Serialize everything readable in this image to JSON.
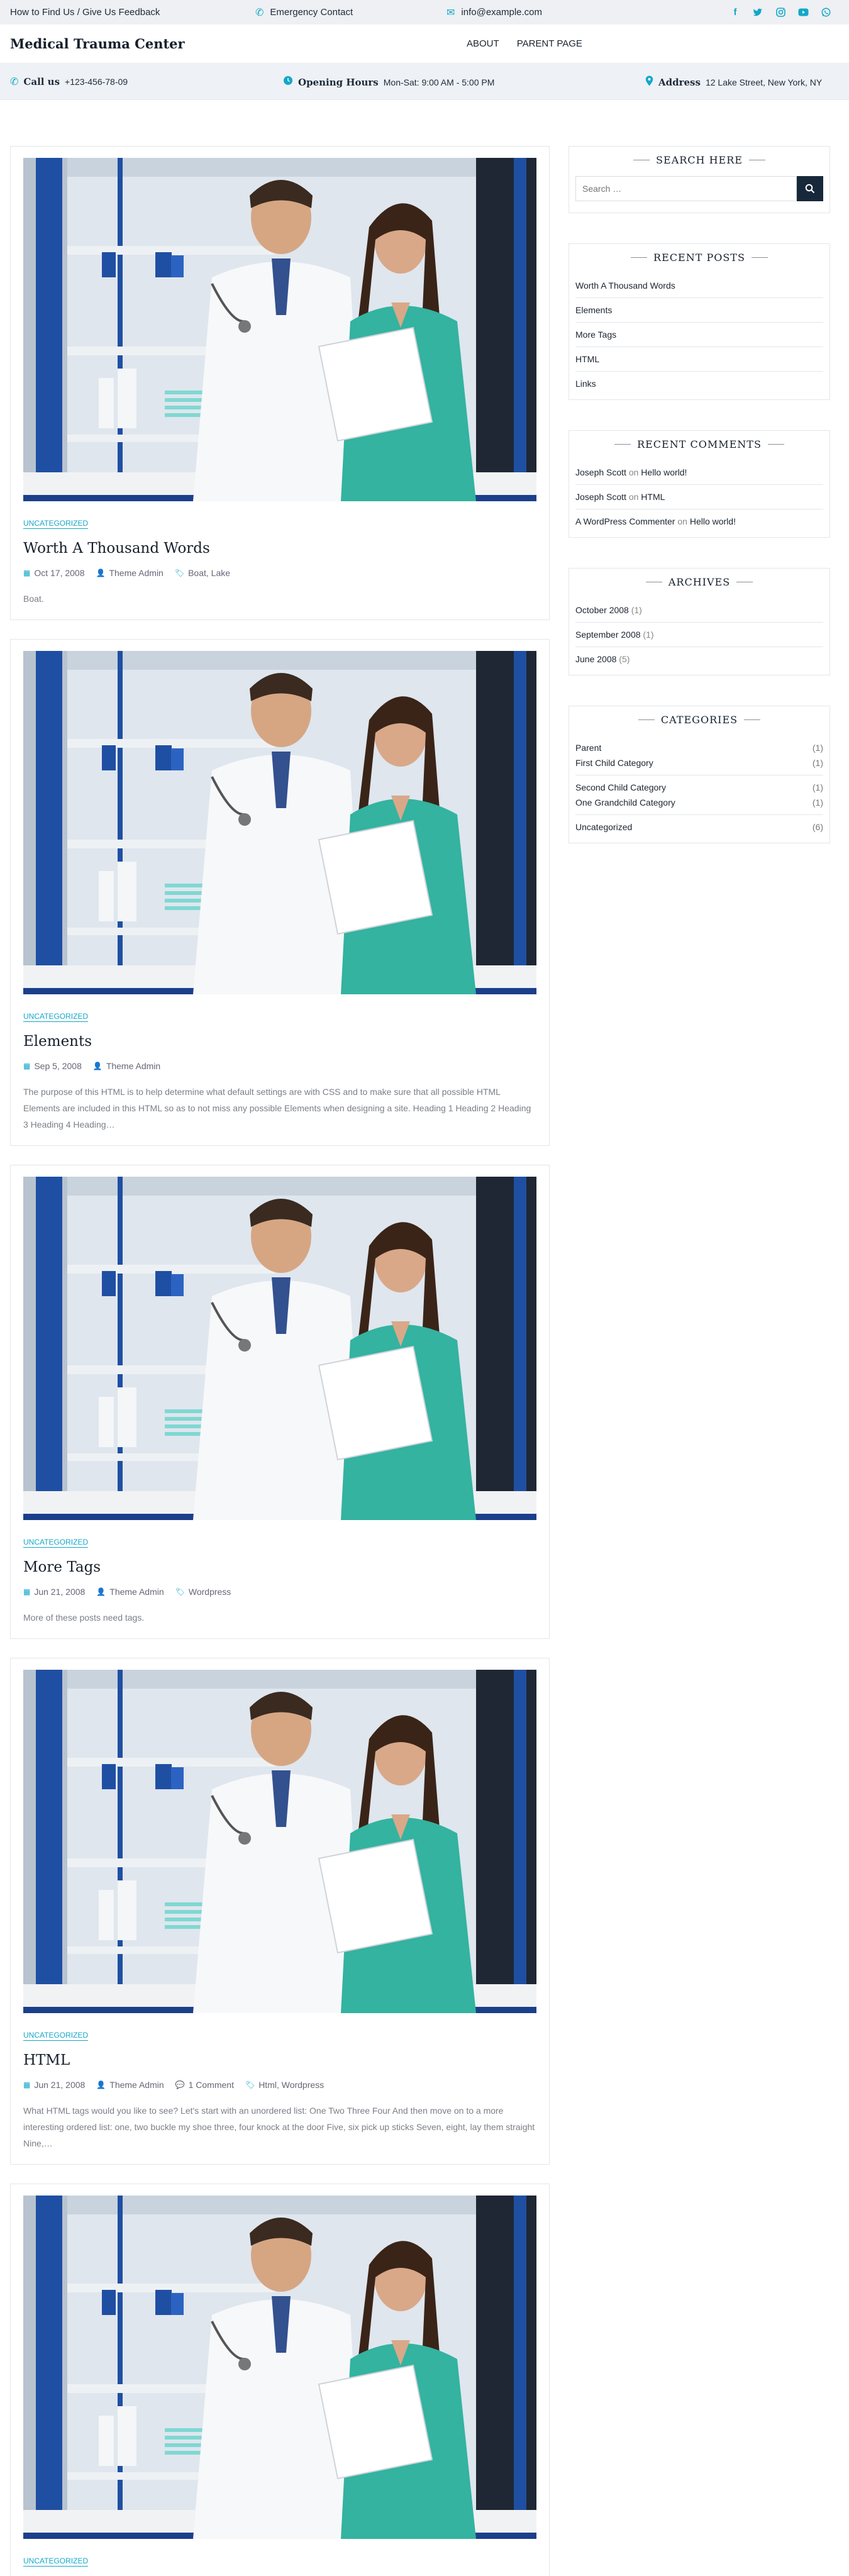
{
  "topbar": {
    "find_us": "How to Find Us / Give Us Feedback",
    "emergency": "Emergency Contact",
    "email": "info@example.com",
    "social": [
      "facebook-icon",
      "twitter-icon",
      "instagram-icon",
      "youtube-icon",
      "whatsapp-icon"
    ]
  },
  "header": {
    "site_title": "Medical Trauma Center",
    "nav": [
      "ABOUT",
      "PARENT PAGE"
    ]
  },
  "infobar": {
    "call_label": "Call us",
    "call_value": "+123-456-78-09",
    "hours_label": "Opening Hours",
    "hours_value": "Mon-Sat: 9:00 AM - 5:00 PM",
    "address_label": "Address",
    "address_value": "12 Lake Street, New York, NY"
  },
  "posts": [
    {
      "category": "UNCATEGORIZED",
      "title": "Worth A Thousand Words",
      "date": "Oct 17, 2008",
      "author": "Theme Admin",
      "comments": "",
      "tags": "Boat, Lake",
      "excerpt": "Boat."
    },
    {
      "category": "UNCATEGORIZED",
      "title": "Elements",
      "date": "Sep 5, 2008",
      "author": "Theme Admin",
      "comments": "",
      "tags": "",
      "excerpt": "The purpose of this HTML is to help determine what default settings are with CSS and to make sure that all possible HTML Elements are included in this HTML so as to not miss any possible Elements when designing a site. Heading 1 Heading 2 Heading 3 Heading 4 Heading…"
    },
    {
      "category": "UNCATEGORIZED",
      "title": "More Tags",
      "date": "Jun 21, 2008",
      "author": "Theme Admin",
      "comments": "",
      "tags": "Wordpress",
      "excerpt": "More of these posts need tags."
    },
    {
      "category": "UNCATEGORIZED",
      "title": "HTML",
      "date": "Jun 21, 2008",
      "author": "Theme Admin",
      "comments": "1 Comment",
      "tags": "Html, Wordpress",
      "excerpt": "What HTML tags would you like to see? Let's start with an unordered list: One Two Three Four And then move on to a more interesting ordered list: one, two buckle my shoe three, four knock at the door Five, six pick up sticks Seven, eight, lay them straight Nine,…"
    },
    {
      "category": "UNCATEGORIZED",
      "title": "",
      "date": "",
      "author": "",
      "comments": "",
      "tags": "",
      "excerpt": ""
    }
  ],
  "sidebar": {
    "search": {
      "title": "SEARCH HERE",
      "placeholder": "Search …"
    },
    "recent_posts": {
      "title": "RECENT POSTS",
      "items": [
        "Worth A Thousand Words",
        "Elements",
        "More Tags",
        "HTML",
        "Links"
      ]
    },
    "recent_comments": {
      "title": "RECENT COMMENTS",
      "items": [
        {
          "author": "Joseph Scott",
          "on": "on",
          "post": "Hello world!"
        },
        {
          "author": "Joseph Scott",
          "on": "on",
          "post": "HTML"
        },
        {
          "author": "A WordPress Commenter",
          "on": "on",
          "post": "Hello world!"
        }
      ]
    },
    "archives": {
      "title": "ARCHIVES",
      "items": [
        {
          "label": "October 2008",
          "count": "(1)"
        },
        {
          "label": "September 2008",
          "count": "(1)"
        },
        {
          "label": "June 2008",
          "count": "(5)"
        }
      ]
    },
    "categories": {
      "title": "CATEGORIES",
      "groups": [
        [
          {
            "label": "Parent",
            "count": "(1)"
          },
          {
            "label": "First Child Category",
            "count": "(1)"
          }
        ],
        [
          {
            "label": "Second Child Category",
            "count": "(1)"
          },
          {
            "label": "One Grandchild Category",
            "count": "(1)"
          }
        ],
        [
          {
            "label": "Uncategorized",
            "count": "(6)"
          }
        ]
      ]
    }
  },
  "colors": {
    "accent": "#12a7c9",
    "dark": "#17283a",
    "topbar_bg": "#eef0f3"
  }
}
